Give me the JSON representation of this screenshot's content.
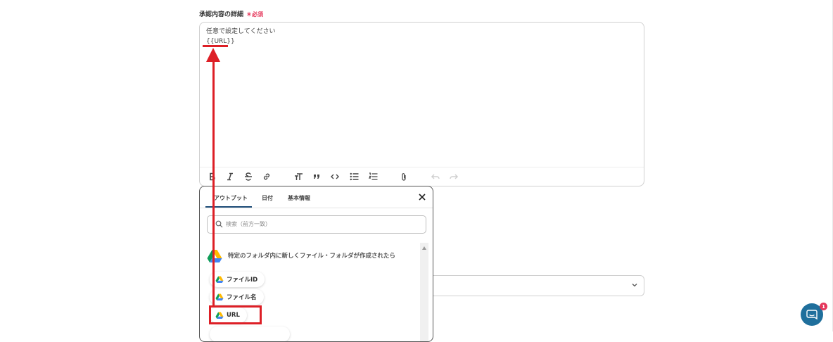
{
  "field": {
    "label": "承認内容の詳細",
    "required_label": "＊必須",
    "lines": [
      "任意で設定してください",
      "{{URL}}"
    ]
  },
  "toolbar": {
    "icons": [
      "bold-icon",
      "italic-icon",
      "strikethrough-icon",
      "link-icon",
      "text-size-icon",
      "quote-icon",
      "code-icon",
      "bullet-list-icon",
      "numbered-list-icon",
      "attach-icon",
      "undo-icon",
      "redo-icon"
    ]
  },
  "popup": {
    "tabs": [
      {
        "label": "アウトプット",
        "active": true
      },
      {
        "label": "日付",
        "active": false
      },
      {
        "label": "基本情報",
        "active": false
      }
    ],
    "search_placeholder": "検索（前方一致）",
    "section_title": "特定のフォルダ内に新しくファイル・フォルダが作成されたら",
    "items": [
      "ファイルID",
      "ファイル名",
      "URL"
    ]
  },
  "chat": {
    "badge": "1"
  },
  "colors": {
    "accent": "#1f4e79",
    "required": "#e5365a",
    "annotation": "#dd1f26",
    "chat": "#1f6f9c"
  }
}
